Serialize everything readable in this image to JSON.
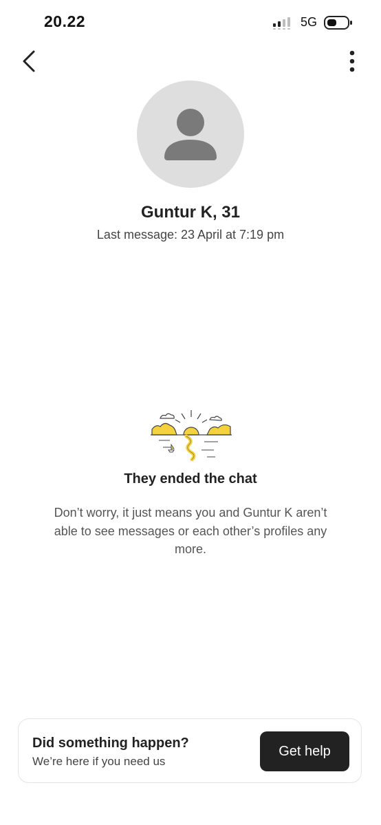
{
  "status_bar": {
    "time": "20.22",
    "network": "5G",
    "icons": [
      "signal-icon",
      "battery-icon"
    ]
  },
  "nav": {
    "back_icon": "chevron-left-icon",
    "more_icon": "more-vertical-icon"
  },
  "profile": {
    "avatar_icon": "person-placeholder-icon",
    "name": "Guntur K, 31",
    "last_message": "Last message: 23 April at 7:19 pm"
  },
  "ended_chat": {
    "illustration": "sunset-landscape-illustration",
    "title": "They ended the chat",
    "body": "Don’t worry, it just means you and Guntur K aren’t able to see messages or each other’s profiles any more."
  },
  "help_card": {
    "title": "Did something happen?",
    "subtitle": "We’re here if you need us",
    "button_label": "Get help"
  },
  "colors": {
    "accent_yellow": "#F5D23C",
    "avatar_bg": "#DEDEDE",
    "avatar_fg": "#7A7A7A",
    "button_bg": "#222222"
  }
}
